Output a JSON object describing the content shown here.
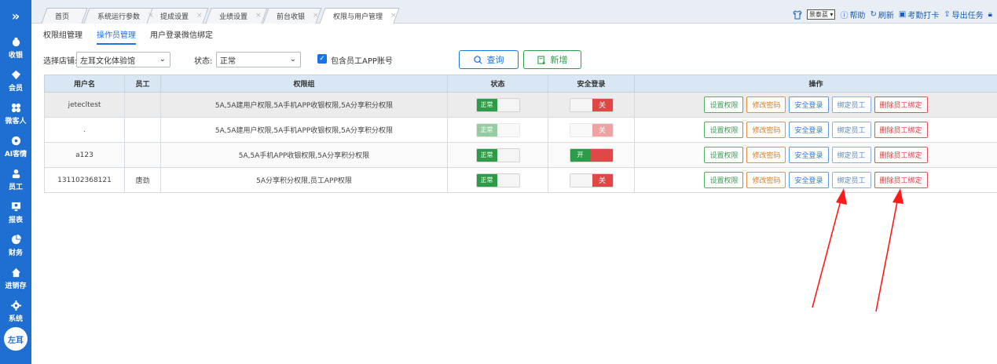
{
  "sidebar": {
    "toggle": "»",
    "items": [
      {
        "label": "收银",
        "icon": "money-bag-icon"
      },
      {
        "label": "会员",
        "icon": "diamond-icon"
      },
      {
        "label": "微客人",
        "icon": "grid-icon"
      },
      {
        "label": "AI客情",
        "icon": "ai-icon"
      },
      {
        "label": "员工",
        "icon": "person-icon"
      },
      {
        "label": "报表",
        "icon": "monitor-icon"
      },
      {
        "label": "财务",
        "icon": "pie-icon"
      },
      {
        "label": "进销存",
        "icon": "home-icon"
      },
      {
        "label": "系统",
        "icon": "gear-icon"
      }
    ],
    "avatar": "左耳"
  },
  "tabs": [
    {
      "label": "首页"
    },
    {
      "label": "系统运行参数"
    },
    {
      "label": "提成设置"
    },
    {
      "label": "业绩设置"
    },
    {
      "label": "前台收银"
    },
    {
      "label": "权限与用户管理"
    }
  ],
  "topbar": {
    "theme": "景泰蓝",
    "help": "帮助",
    "refresh": "刷新",
    "attendance": "考勤打卡",
    "export": "导出任务"
  },
  "subtabs": [
    {
      "label": "权限组管理"
    },
    {
      "label": "操作员管理"
    },
    {
      "label": "用户登录微信绑定"
    }
  ],
  "filters": {
    "store_label": "选择店铺:",
    "store_value": "左耳文化体验馆",
    "status_label": "状态:",
    "status_value": "正常",
    "include_label": "包含员工APP账号",
    "query": "查询",
    "add": "新增"
  },
  "table": {
    "headers": [
      "用户名",
      "员工",
      "权限组",
      "状态",
      "安全登录",
      "操作"
    ],
    "status_on": "正常",
    "secure_on": "开",
    "secure_off": "关",
    "ops": [
      "设置权限",
      "修改密码",
      "安全登录",
      "绑定员工",
      "删除员工绑定"
    ],
    "rows": [
      {
        "username": "jetecltest",
        "employee": "",
        "groups": "5A,5A建用户权限,5A手机APP收银权限,5A分享积分权限"
      },
      {
        "username": ".",
        "employee": "",
        "groups": "5A,5A建用户权限,5A手机APP收银权限,5A分享积分权限"
      },
      {
        "username": "a123",
        "employee": "",
        "groups": "5A,5A手机APP收银权限,5A分享积分权限"
      },
      {
        "username": "131102368121",
        "employee": "唐劲",
        "groups": "5A分享积分权限,员工APP权限"
      }
    ]
  },
  "colors": {
    "sidebar": "#1e6fd1",
    "accent": "#1a73e8",
    "green": "#2e9b48",
    "red": "#e04848",
    "arrow": "#ff1a1a"
  }
}
